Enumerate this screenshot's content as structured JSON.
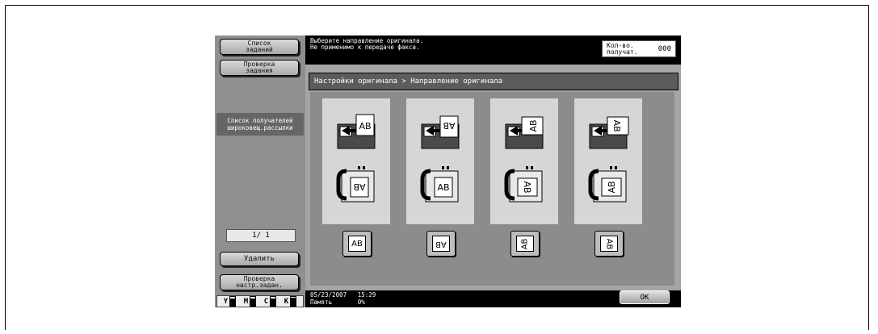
{
  "sidebar": {
    "job_list_label": "Список\nзаданий",
    "job_check_label": "Проверка\nзадания",
    "broadcast_label": "Список получателей\nшироковещ.рассылки",
    "page_counter": "1/ 1",
    "delete_label": "Удалить",
    "settings_check_label": "Проверка\nнастр.задан.",
    "toner": [
      {
        "letter": "Y",
        "level": 0.85
      },
      {
        "letter": "M",
        "level": 0.85
      },
      {
        "letter": "C",
        "level": 0.85
      },
      {
        "letter": "K",
        "level": 0.95
      }
    ]
  },
  "header": {
    "message": "Выберите направление оригинала.\nНе применимо к передаче факса.",
    "recipients_label": "Кол-во.\nполучат.",
    "recipients_value": "000"
  },
  "breadcrumb": "Настройки оригинала > Направление оригинала",
  "orientations": [
    {
      "name": "top-up",
      "label": "AB"
    },
    {
      "name": "top-down",
      "label": "AB"
    },
    {
      "name": "top-left",
      "label": "AB"
    },
    {
      "name": "top-right",
      "label": "AB"
    }
  ],
  "footer": {
    "datetime": "05/23/2007   15:29",
    "memory": "Память       0%",
    "ok_label": "OK"
  }
}
